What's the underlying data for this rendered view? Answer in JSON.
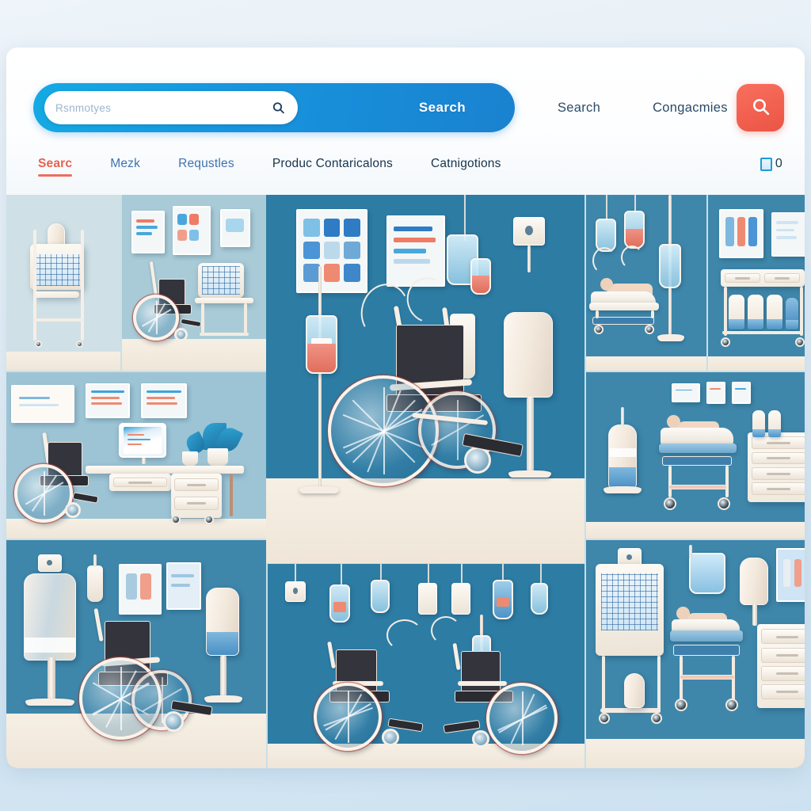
{
  "page": {
    "background_color": "#dfecf5",
    "card_background": "#ffffff"
  },
  "header": {
    "search": {
      "placeholder": "Rsnmotyes",
      "value": "",
      "inner_icon": "search-icon",
      "submit_label": "Search",
      "pill_color": "#1794dd"
    },
    "links": [
      {
        "label": "Search"
      },
      {
        "label": "Congacmies"
      }
    ],
    "icon_button": {
      "icon": "search-icon",
      "color": "#f2604f"
    }
  },
  "tabs": {
    "items": [
      {
        "label": "Searc",
        "active": true,
        "style": "accent"
      },
      {
        "label": "Mezk",
        "active": false,
        "style": "link"
      },
      {
        "label": "Requstles",
        "active": false,
        "style": "link"
      },
      {
        "label": "Produc Contaricalons",
        "active": false,
        "style": "dark"
      },
      {
        "label": "Catnigotions",
        "active": false,
        "style": "dark"
      }
    ],
    "cart": {
      "icon": "cart-icon",
      "count": "0"
    },
    "active_color": "#ea5f50",
    "link_color": "#3e72b0"
  },
  "gallery": {
    "tiles": [
      {
        "id": "tile-cart-cage",
        "name": "medical-supply-cart",
        "caption": "Medical supply cart with wire basket"
      },
      {
        "id": "tile-clinic-office",
        "name": "clinic-office-wheelchair",
        "caption": "Clinic office with wheelchair and desk"
      },
      {
        "id": "tile-featured",
        "name": "featured-wheelchair",
        "caption": "Wheelchair with IV stand and oxygen canister"
      },
      {
        "id": "tile-bed-iv",
        "name": "hospital-bed-iv",
        "caption": "Hospital bed with IV drip stand"
      },
      {
        "id": "tile-cart-bottles",
        "name": "supply-cart-bottles",
        "caption": "Supply cart with oxygen bottles"
      },
      {
        "id": "tile-desk-wheelchair",
        "name": "office-desk-wheelchair",
        "caption": "Office desk, monitor and wheelchair"
      },
      {
        "id": "tile-bed-cabinet",
        "name": "patient-bed-cabinet",
        "caption": "Patient bed, cylinder and drawer cabinet"
      },
      {
        "id": "tile-oxygen-wc",
        "name": "oxygen-wheelchair-room",
        "caption": "Oxygen cylinders with wheelchair"
      },
      {
        "id": "tile-two-wheelchairs",
        "name": "two-wheelchairs-iv",
        "caption": "Two wheelchairs with IV accessories"
      },
      {
        "id": "tile-monitor-bed",
        "name": "monitor-bed-cabinet",
        "caption": "Patient monitor, bed and cabinet"
      }
    ]
  }
}
